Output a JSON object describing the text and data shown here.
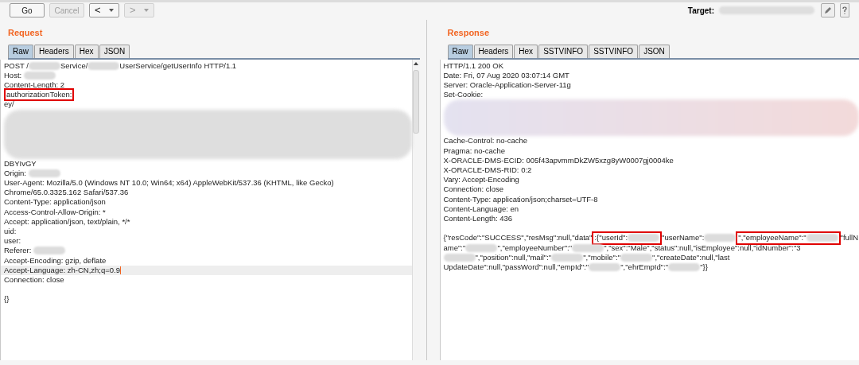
{
  "toolbar": {
    "buttons": [
      {
        "kind": "text",
        "label": "Go",
        "disabled": false
      },
      {
        "kind": "text",
        "label": "Cancel",
        "disabled": true
      },
      {
        "kind": "back",
        "label": "<",
        "disabled": false
      },
      {
        "kind": "forward",
        "label": ">",
        "disabled": true
      }
    ],
    "target_label": "Target:"
  },
  "request": {
    "title": "Request",
    "tabs": [
      {
        "label": "Raw",
        "selected": true
      },
      {
        "label": "Headers",
        "selected": false
      },
      {
        "label": "Hex",
        "selected": false
      },
      {
        "label": "JSON",
        "selected": false
      }
    ],
    "lines": [
      {
        "current": false,
        "parts": [
          {
            "kind": "text",
            "text": "POST /"
          },
          {
            "kind": "redacted"
          },
          {
            "kind": "text",
            "text": "Service/"
          },
          {
            "kind": "redacted"
          },
          {
            "kind": "text",
            "text": "UserService/getUserInfo HTTP/1.1"
          }
        ]
      },
      {
        "current": false,
        "parts": [
          {
            "kind": "text",
            "text": "Host: "
          },
          {
            "kind": "redacted"
          }
        ]
      },
      {
        "current": false,
        "parts": [
          {
            "kind": "text",
            "text": "Content-Length: 2"
          }
        ]
      },
      {
        "current": false,
        "parts": [
          {
            "kind": "boxed",
            "parts": [
              {
                "kind": "text",
                "text": "authorizationToken:"
              }
            ]
          }
        ]
      },
      {
        "current": false,
        "parts": [
          {
            "kind": "text",
            "text": "ey/"
          }
        ]
      },
      {
        "current": false,
        "parts": [
          {
            "kind": "block"
          }
        ]
      },
      {
        "current": false,
        "parts": [
          {
            "kind": "text",
            "text": "DBYIvGY"
          }
        ]
      },
      {
        "current": false,
        "parts": [
          {
            "kind": "text",
            "text": "Origin: "
          },
          {
            "kind": "redacted"
          }
        ]
      },
      {
        "current": false,
        "parts": [
          {
            "kind": "text",
            "text": "User-Agent: Mozilla/5.0 (Windows NT 10.0; Win64; x64) AppleWebKit/537.36 (KHTML, like Gecko)"
          }
        ]
      },
      {
        "current": false,
        "parts": [
          {
            "kind": "text",
            "text": "Chrome/65.0.3325.162 Safari/537.36"
          }
        ]
      },
      {
        "current": false,
        "parts": [
          {
            "kind": "text",
            "text": "Content-Type: application/json"
          }
        ]
      },
      {
        "current": false,
        "parts": [
          {
            "kind": "text",
            "text": "Access-Control-Allow-Origin: *"
          }
        ]
      },
      {
        "current": false,
        "parts": [
          {
            "kind": "text",
            "text": "Accept: application/json, text/plain, */*"
          }
        ]
      },
      {
        "current": false,
        "parts": [
          {
            "kind": "text",
            "text": "uid:"
          }
        ]
      },
      {
        "current": false,
        "parts": [
          {
            "kind": "text",
            "text": "user:"
          }
        ]
      },
      {
        "current": false,
        "parts": [
          {
            "kind": "text",
            "text": "Referer: "
          },
          {
            "kind": "redacted"
          }
        ]
      },
      {
        "current": false,
        "parts": [
          {
            "kind": "text",
            "text": "Accept-Encoding: gzip, deflate"
          }
        ]
      },
      {
        "current": true,
        "parts": [
          {
            "kind": "text",
            "text": "Accept-Language: zh-CN,zh;q=0.9"
          }
        ]
      },
      {
        "current": false,
        "parts": [
          {
            "kind": "text",
            "text": "Connection: close"
          }
        ]
      },
      {
        "current": false
      },
      {
        "current": false,
        "parts": [
          {
            "kind": "text",
            "text": "{}"
          }
        ]
      }
    ]
  },
  "response": {
    "title": "Response",
    "tabs": [
      {
        "label": "Raw",
        "selected": true
      },
      {
        "label": "Headers",
        "selected": false
      },
      {
        "label": "Hex",
        "selected": false
      },
      {
        "label": "SSTVINFO",
        "selected": false
      },
      {
        "label": "SSTVINFO",
        "selected": false
      },
      {
        "label": "JSON",
        "selected": false
      }
    ],
    "lines": [
      {
        "current": false,
        "parts": [
          {
            "kind": "text",
            "text": "HTTP/1.1 200 OK"
          }
        ]
      },
      {
        "current": false,
        "parts": [
          {
            "kind": "text",
            "text": "Date: Fri, 07 Aug 2020 03:07:14 GMT"
          }
        ]
      },
      {
        "current": false,
        "parts": [
          {
            "kind": "text",
            "text": "Server: Oracle-Application-Server-11g"
          }
        ]
      },
      {
        "current": false,
        "parts": [
          {
            "kind": "text",
            "text": "Set-Cookie:"
          }
        ]
      },
      {
        "current": false,
        "parts": [
          {
            "kind": "block"
          }
        ]
      },
      {
        "current": false,
        "parts": [
          {
            "kind": "text",
            "text": "Cache-Control: no-cache"
          }
        ]
      },
      {
        "current": false,
        "parts": [
          {
            "kind": "text",
            "text": "Pragma: no-cache"
          }
        ]
      },
      {
        "current": false,
        "parts": [
          {
            "kind": "text",
            "text": "X-ORACLE-DMS-ECID: 005f43apvmmDkZW5xzg8yW0007gj0004ke"
          }
        ]
      },
      {
        "current": false,
        "parts": [
          {
            "kind": "text",
            "text": "X-ORACLE-DMS-RID: 0:2"
          }
        ]
      },
      {
        "current": false,
        "parts": [
          {
            "kind": "text",
            "text": "Vary: Accept-Encoding"
          }
        ]
      },
      {
        "current": false,
        "parts": [
          {
            "kind": "text",
            "text": "Connection: close"
          }
        ]
      },
      {
        "current": false,
        "parts": [
          {
            "kind": "text",
            "text": "Content-Type: application/json;charset=UTF-8"
          }
        ]
      },
      {
        "current": false,
        "parts": [
          {
            "kind": "text",
            "text": "Content-Language: en"
          }
        ]
      },
      {
        "current": false,
        "parts": [
          {
            "kind": "text",
            "text": "Content-Length: 436"
          }
        ]
      },
      {
        "current": false
      },
      {
        "current": false,
        "parts": [
          {
            "kind": "text",
            "text": "{\"resCode\":\"SUCCESS\",\"resMsg\":null,\"data\""
          },
          {
            "kind": "boxed",
            "parts": [
              {
                "kind": "text",
                "text": ":{\"userId\":"
              },
              {
                "kind": "redacted"
              }
            ]
          },
          {
            "kind": "text",
            "text": "\"userName\":"
          },
          {
            "kind": "redacted"
          },
          {
            "kind": "boxed",
            "parts": [
              {
                "kind": "text",
                "text": "\",\"employeeName\":\""
              },
              {
                "kind": "redacted"
              }
            ]
          },
          {
            "kind": "text",
            "text": "\"fullN"
          }
        ]
      },
      {
        "current": false,
        "parts": [
          {
            "kind": "text",
            "text": "ame\":\""
          },
          {
            "kind": "redacted"
          },
          {
            "kind": "text",
            "text": "\",\"employeeNumber\":\""
          },
          {
            "kind": "redacted"
          },
          {
            "kind": "text",
            "text": "\",\"sex\":\"Male\",\"status\":null,\"isEmployee\":null,\"idNumber\":\"3"
          }
        ]
      },
      {
        "current": false,
        "parts": [
          {
            "kind": "redacted"
          },
          {
            "kind": "text",
            "text": "\",\"position\":null,\"mail\":\""
          },
          {
            "kind": "redacted"
          },
          {
            "kind": "text",
            "text": "\",\"mobile\":\""
          },
          {
            "kind": "redacted"
          },
          {
            "kind": "text",
            "text": "\",\"createDate\":null,\"last"
          }
        ]
      },
      {
        "current": false,
        "parts": [
          {
            "kind": "text",
            "text": "UpdateDate\":null,\"passWord\":null,\"empId\":\""
          },
          {
            "kind": "redacted"
          },
          {
            "kind": "text",
            "text": "\",\"ehrEmpId\":\""
          },
          {
            "kind": "redacted"
          },
          {
            "kind": "text",
            "text": "\"}}"
          }
        ]
      }
    ]
  }
}
